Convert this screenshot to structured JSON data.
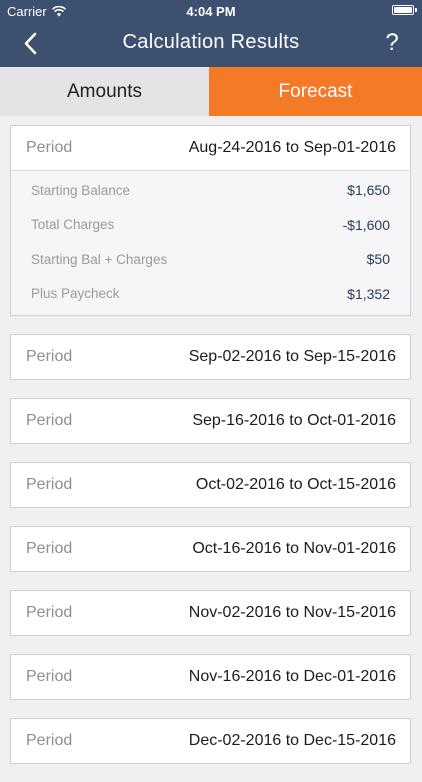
{
  "status_bar": {
    "carrier": "Carrier",
    "time": "4:04 PM"
  },
  "nav": {
    "title": "Calculation Results",
    "help": "?"
  },
  "tabs": [
    {
      "label": "Amounts",
      "active": false
    },
    {
      "label": "Forecast",
      "active": true
    }
  ],
  "colors": {
    "nav_bg": "#3e5070",
    "accent": "#f57a28",
    "value_text": "#2a3b5c"
  },
  "periods": [
    {
      "label": "Period",
      "range": "Aug-24-2016 to Sep-01-2016",
      "expanded": true,
      "details": [
        {
          "label": "Starting Balance",
          "value": "$1,650"
        },
        {
          "label": "Total Charges",
          "value": "-$1,600"
        },
        {
          "label": "Starting Bal + Charges",
          "value": "$50"
        },
        {
          "label": "Plus Paycheck",
          "value": "$1,352"
        }
      ]
    },
    {
      "label": "Period",
      "range": "Sep-02-2016 to Sep-15-2016"
    },
    {
      "label": "Period",
      "range": "Sep-16-2016 to Oct-01-2016"
    },
    {
      "label": "Period",
      "range": "Oct-02-2016 to Oct-15-2016"
    },
    {
      "label": "Period",
      "range": "Oct-16-2016 to Nov-01-2016"
    },
    {
      "label": "Period",
      "range": "Nov-02-2016 to Nov-15-2016"
    },
    {
      "label": "Period",
      "range": "Nov-16-2016 to Dec-01-2016"
    },
    {
      "label": "Period",
      "range": "Dec-02-2016 to Dec-15-2016"
    }
  ]
}
